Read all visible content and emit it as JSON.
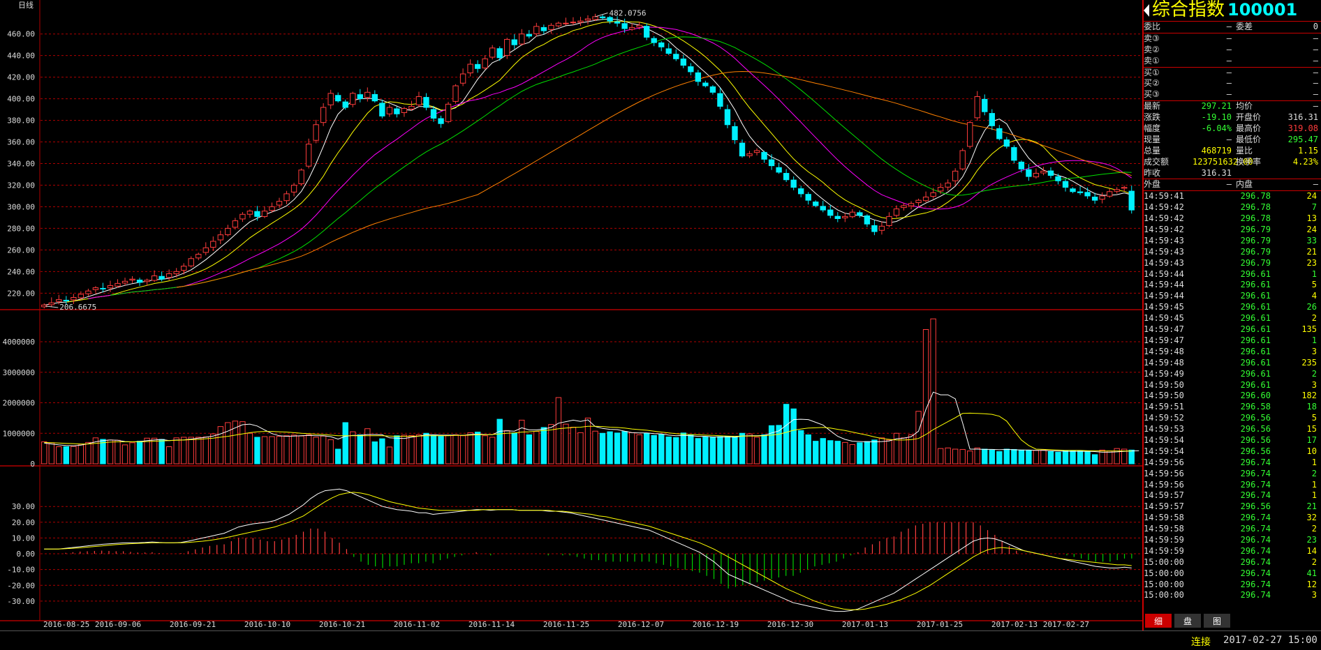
{
  "period_label": "日线",
  "colors": {
    "up": "#ff3c3c",
    "down": "#00f0ff",
    "ma5": "#ffffff",
    "ma10": "#ffff00",
    "ma20": "#ff00ff",
    "ma30": "#00e000",
    "ma60": "#ff8000",
    "grid": "#b00000",
    "dif": "#ffffff",
    "dea": "#ffff00"
  },
  "chart_data": [
    {
      "type": "candlestick",
      "ylim": [
        206,
        485
      ],
      "yticks": [
        "460.00",
        "440.00",
        "420.00",
        "400.00",
        "380.00",
        "360.00",
        "340.00",
        "320.00",
        "300.00",
        "280.00",
        "260.00",
        "240.00",
        "220.00"
      ],
      "high_label": "482.0756",
      "low_label": "206.6675",
      "x_date_labels": [
        "2016-08-25",
        "2016-09-06",
        "2016-09-21",
        "2016-10-10",
        "2016-10-21",
        "2016-11-02",
        "2016-11-14",
        "2016-11-25",
        "2016-12-07",
        "2016-12-19",
        "2016-12-30",
        "2017-01-13",
        "2017-01-25",
        "2017-02-13",
        "2017-02-27"
      ],
      "closes": [
        209,
        211,
        214,
        213,
        216,
        219,
        222,
        225,
        224,
        227,
        229,
        231,
        233,
        230,
        232,
        236,
        233,
        238,
        240,
        245,
        252,
        256,
        262,
        268,
        274,
        280,
        287,
        293,
        296,
        291,
        296,
        300,
        305,
        312,
        320,
        334,
        358,
        376,
        392,
        405,
        398,
        392,
        405,
        400,
        406,
        398,
        384,
        392,
        386,
        391,
        393,
        402,
        392,
        382,
        377,
        395,
        412,
        423,
        432,
        428,
        437,
        447,
        438,
        455,
        450,
        460,
        458,
        467,
        463,
        468,
        470,
        470,
        471,
        472,
        474,
        476,
        475,
        472,
        470,
        465,
        466,
        468,
        457,
        452,
        448,
        442,
        437,
        431,
        425,
        416,
        412,
        406,
        393,
        376,
        362,
        347,
        349,
        352,
        344,
        338,
        332,
        325,
        318,
        312,
        306,
        301,
        297,
        292,
        289,
        291,
        295,
        292,
        284,
        277,
        282,
        291,
        298,
        301,
        303,
        306,
        309,
        313,
        318,
        322,
        333,
        352,
        378,
        402,
        388,
        375,
        363,
        356,
        343,
        335,
        328,
        331,
        333,
        329,
        324,
        318,
        314,
        313,
        310,
        306,
        310,
        314,
        316,
        318,
        297
      ]
    },
    {
      "type": "bar",
      "name": "volume",
      "ylim": [
        0,
        4800000
      ],
      "yticks": [
        "4000000",
        "3000000",
        "2000000",
        "1000000",
        "0"
      ],
      "values": [
        720000,
        690000,
        560000,
        560000,
        570000,
        620000,
        700000,
        850000,
        800000,
        780000,
        770000,
        620000,
        690000,
        740000,
        840000,
        840000,
        800000,
        560000,
        850000,
        870000,
        870000,
        870000,
        880000,
        980000,
        1220000,
        1350000,
        1400000,
        1380000,
        1000000,
        870000,
        890000,
        890000,
        900000,
        920000,
        940000,
        910000,
        950000,
        870000,
        910000,
        790000,
        480000,
        1350000,
        1050000,
        950000,
        1150000,
        720000,
        820000,
        550000,
        920000,
        940000,
        930000,
        950000,
        1000000,
        930000,
        900000,
        930000,
        950000,
        920000,
        1020000,
        1040000,
        920000,
        870000,
        1460000,
        1090000,
        1010000,
        1430000,
        950000,
        1060000,
        1190000,
        1290000,
        2170000,
        1300000,
        1200000,
        1020000,
        1500000,
        1070000,
        1000000,
        1050000,
        1010000,
        1060000,
        1020000,
        950000,
        1000000,
        930000,
        960000,
        880000,
        860000,
        1010000,
        940000,
        830000,
        890000,
        870000,
        890000,
        900000,
        880000,
        1000000,
        980000,
        870000,
        950000,
        1250000,
        1260000,
        1950000,
        1800000,
        1090000,
        950000,
        740000,
        830000,
        760000,
        740000,
        700000,
        630000,
        690000,
        730000,
        780000,
        850000,
        780000,
        1000000,
        850000,
        950000,
        1720000,
        4400000,
        4750000,
        500000,
        520000,
        480000,
        470000,
        420000,
        520000,
        480000,
        450000,
        400000,
        480000,
        470000,
        450000,
        440000,
        440000,
        450000,
        400000,
        380000,
        430000,
        430000,
        420000,
        400000,
        300000,
        450000,
        420000,
        500000,
        480000,
        450000
      ],
      "ma5": [
        680000,
        650000,
        620000,
        600000,
        590000,
        610000,
        660000,
        720000,
        760000,
        780000,
        770000,
        730000,
        720000,
        730000,
        760000,
        780000,
        800000,
        760000,
        780000,
        780000,
        810000,
        840000,
        870000,
        910000,
        980000,
        1070000,
        1180000,
        1280000,
        1300000,
        1240000,
        1110000,
        990000,
        920000,
        900000,
        910000,
        920000,
        930000,
        920000,
        920000,
        890000,
        810000,
        900000,
        930000,
        930000,
        960000,
        960000,
        950000,
        850000,
        840000,
        830000,
        870000,
        910000,
        950000,
        950000,
        940000,
        940000,
        940000,
        930000,
        960000,
        970000,
        960000,
        950000,
        1070000,
        1080000,
        1070000,
        1180000,
        1110000,
        1110000,
        1140000,
        1190000,
        1330000,
        1380000,
        1430000,
        1390000,
        1440000,
        1220000,
        1160000,
        1130000,
        1120000,
        1070000,
        1020000,
        1010000,
        1010000,
        990000,
        980000,
        940000,
        920000,
        930000,
        920000,
        900000,
        900000,
        880000,
        880000,
        880000,
        870000,
        910000,
        920000,
        920000,
        930000,
        1010000,
        1080000,
        1260000,
        1450000,
        1460000,
        1450000,
        1360000,
        1270000,
        1080000,
        900000,
        800000,
        740000,
        730000,
        720000,
        720000,
        730000,
        750000,
        820000,
        840000,
        890000,
        1070000,
        1780000,
        2350000,
        2260000,
        2260000,
        2130000,
        1340000,
        480000,
        480000,
        470000,
        470000,
        460000,
        470000,
        460000,
        450000,
        450000,
        440000,
        440000,
        430000,
        420000,
        410000,
        410000,
        410000,
        410000,
        400000,
        380000,
        380000,
        390000,
        410000,
        420000,
        430000
      ],
      "ma10": [
        700000,
        690000,
        680000,
        670000,
        660000,
        650000,
        650000,
        670000,
        690000,
        710000,
        720000,
        720000,
        720000,
        720000,
        730000,
        740000,
        750000,
        760000,
        770000,
        780000,
        790000,
        800000,
        820000,
        840000,
        870000,
        900000,
        940000,
        980000,
        1020000,
        1050000,
        1060000,
        1060000,
        1050000,
        1040000,
        1020000,
        1000000,
        990000,
        970000,
        960000,
        940000,
        920000,
        920000,
        920000,
        920000,
        920000,
        920000,
        920000,
        910000,
        900000,
        900000,
        900000,
        910000,
        920000,
        920000,
        920000,
        920000,
        930000,
        930000,
        940000,
        950000,
        950000,
        960000,
        980000,
        1000000,
        1010000,
        1040000,
        1050000,
        1070000,
        1090000,
        1110000,
        1150000,
        1170000,
        1190000,
        1200000,
        1230000,
        1230000,
        1220000,
        1200000,
        1190000,
        1170000,
        1140000,
        1120000,
        1100000,
        1070000,
        1040000,
        1010000,
        990000,
        970000,
        960000,
        950000,
        940000,
        930000,
        920000,
        910000,
        900000,
        910000,
        910000,
        910000,
        920000,
        940000,
        970000,
        1030000,
        1100000,
        1140000,
        1170000,
        1180000,
        1190000,
        1170000,
        1130000,
        1090000,
        1040000,
        990000,
        940000,
        880000,
        830000,
        800000,
        780000,
        780000,
        790000,
        830000,
        960000,
        1120000,
        1250000,
        1380000,
        1510000,
        1650000,
        1660000,
        1650000,
        1640000,
        1620000,
        1560000,
        1400000,
        1080000,
        780000,
        600000,
        480000,
        470000,
        460000,
        450000,
        440000,
        440000,
        440000,
        430000,
        430000,
        420000,
        420000,
        420000,
        420000,
        420000
      ]
    },
    {
      "type": "line",
      "name": "macd",
      "ylim": [
        -38,
        46
      ],
      "yticks": [
        "30.00",
        "20.00",
        "10.00",
        "0.00",
        "-10.00",
        "-20.00",
        "-30.00"
      ],
      "dif": [
        3,
        3,
        3,
        3.5,
        4,
        4.5,
        5,
        5.5,
        6,
        6.3,
        6.6,
        6.9,
        7,
        7,
        7.2,
        7.5,
        7.2,
        7,
        7,
        7.2,
        8,
        9,
        10,
        11,
        12,
        13,
        15,
        17,
        18,
        19,
        19.5,
        20,
        21,
        23,
        25,
        28,
        31,
        35,
        38,
        40,
        40.5,
        41,
        40,
        38,
        36,
        34,
        32,
        30,
        29,
        28,
        27.5,
        27,
        26,
        26,
        25,
        25.5,
        26,
        26.5,
        27,
        27.5,
        28,
        28,
        27.5,
        28,
        28,
        28,
        27.5,
        27.5,
        27.5,
        27.5,
        27,
        27,
        26.5,
        26,
        25,
        24,
        23,
        22,
        21,
        20,
        19,
        18,
        17,
        16,
        15,
        13,
        11,
        9,
        7,
        5,
        3,
        1,
        -2,
        -5,
        -9,
        -13,
        -15,
        -17,
        -19,
        -21,
        -23,
        -25,
        -27,
        -29,
        -31,
        -32,
        -33,
        -34,
        -35,
        -36,
        -36.5,
        -36.5,
        -36,
        -35,
        -33,
        -31,
        -29,
        -27,
        -25,
        -22,
        -19,
        -16,
        -13,
        -10,
        -7,
        -4,
        -1,
        2,
        5,
        8,
        9.5,
        10,
        9.5,
        8,
        6,
        4,
        2,
        1,
        0,
        -1,
        -2,
        -3,
        -4,
        -5,
        -6,
        -7,
        -8,
        -8.5,
        -9,
        -9,
        -8.5,
        -9
      ],
      "dea": [
        3,
        3,
        3,
        3.2,
        3.5,
        3.8,
        4.2,
        4.6,
        5,
        5.4,
        5.8,
        6.1,
        6.4,
        6.6,
        6.8,
        7,
        7,
        7,
        7,
        7,
        7.2,
        7.6,
        8,
        8.5,
        9.2,
        10,
        11,
        12,
        13,
        14,
        15,
        16,
        17,
        18.5,
        20,
        22,
        24,
        27,
        30,
        33,
        35.5,
        37.5,
        38.5,
        39,
        38.5,
        37.5,
        36,
        34.5,
        33,
        32,
        31,
        30,
        29,
        28.5,
        28,
        27.5,
        27.5,
        27.5,
        27.5,
        27.5,
        27.5,
        28,
        28,
        28,
        28,
        28,
        27.5,
        27.5,
        27.5,
        27.5,
        27.5,
        27,
        27,
        26.5,
        26,
        25.5,
        25,
        24,
        23.5,
        22.5,
        21.5,
        20.5,
        19.5,
        18.5,
        17.5,
        16,
        14.5,
        13,
        11.5,
        10,
        8.5,
        7,
        5,
        3,
        0.5,
        -2,
        -4.5,
        -7,
        -9.5,
        -12,
        -14.5,
        -17,
        -19.5,
        -22,
        -24,
        -26,
        -28,
        -30,
        -31.5,
        -33,
        -34,
        -35,
        -35.5,
        -35.5,
        -35,
        -34,
        -33,
        -32,
        -30.5,
        -29,
        -27,
        -25,
        -22.5,
        -20,
        -17,
        -14,
        -11,
        -8,
        -5,
        -2,
        0.5,
        2.5,
        3.5,
        4,
        3.5,
        3,
        2,
        1,
        0,
        -1,
        -2,
        -3,
        -3.5,
        -4,
        -4.5,
        -5,
        -5.5,
        -6,
        -6.5,
        -7,
        -7,
        -7.5
      ]
    }
  ],
  "quote_panel": {
    "title": "综合指数",
    "code": "100001",
    "ratio_row": [
      "委比",
      "—",
      "委差",
      "0"
    ],
    "sell": [
      [
        "卖③",
        "—",
        "—"
      ],
      [
        "卖②",
        "—",
        "—"
      ],
      [
        "卖①",
        "—",
        "—"
      ]
    ],
    "buy": [
      [
        "买①",
        "—",
        "—"
      ],
      [
        "买②",
        "—",
        "—"
      ],
      [
        "买③",
        "—",
        "—"
      ]
    ],
    "stats": [
      [
        "最新",
        "297.21",
        "均价",
        "—"
      ],
      [
        "涨跌",
        "-19.10",
        "开盘价",
        "316.31"
      ],
      [
        "幅度",
        "-6.04%",
        "最高价",
        "319.08"
      ],
      [
        "现量",
        "—",
        "最低价",
        "295.47"
      ],
      [
        "总量",
        "468719",
        "量比",
        "1.15"
      ],
      [
        "成交额",
        "123751632.00",
        "换手率",
        "4.23%"
      ],
      [
        "昨收",
        "316.31",
        "",
        ""
      ]
    ],
    "outer_inner": [
      "外盘",
      "—",
      "内盘",
      "—"
    ],
    "ticks": [
      [
        "14:59:41",
        "296.78",
        "24"
      ],
      [
        "14:59:42",
        "296.78",
        "7"
      ],
      [
        "14:59:42",
        "296.78",
        "13"
      ],
      [
        "14:59:42",
        "296.79",
        "24"
      ],
      [
        "14:59:43",
        "296.79",
        "33"
      ],
      [
        "14:59:43",
        "296.79",
        "21"
      ],
      [
        "14:59:43",
        "296.79",
        "23"
      ],
      [
        "14:59:44",
        "296.61",
        "1"
      ],
      [
        "14:59:44",
        "296.61",
        "5"
      ],
      [
        "14:59:44",
        "296.61",
        "4"
      ],
      [
        "14:59:45",
        "296.61",
        "26"
      ],
      [
        "14:59:45",
        "296.61",
        "2"
      ],
      [
        "14:59:47",
        "296.61",
        "135"
      ],
      [
        "14:59:47",
        "296.61",
        "1"
      ],
      [
        "14:59:48",
        "296.61",
        "3"
      ],
      [
        "14:59:48",
        "296.61",
        "235"
      ],
      [
        "14:59:49",
        "296.61",
        "2"
      ],
      [
        "14:59:50",
        "296.61",
        "3"
      ],
      [
        "14:59:50",
        "296.60",
        "182"
      ],
      [
        "14:59:51",
        "296.58",
        "18"
      ],
      [
        "14:59:52",
        "296.56",
        "5"
      ],
      [
        "14:59:53",
        "296.56",
        "15"
      ],
      [
        "14:59:54",
        "296.56",
        "17"
      ],
      [
        "14:59:54",
        "296.56",
        "10"
      ],
      [
        "14:59:56",
        "296.74",
        "1"
      ],
      [
        "14:59:56",
        "296.74",
        "2"
      ],
      [
        "14:59:56",
        "296.74",
        "1"
      ],
      [
        "14:59:57",
        "296.74",
        "1"
      ],
      [
        "14:59:57",
        "296.56",
        "21"
      ],
      [
        "14:59:58",
        "296.74",
        "32"
      ],
      [
        "14:59:58",
        "296.74",
        "2"
      ],
      [
        "14:59:59",
        "296.74",
        "23"
      ],
      [
        "14:59:59",
        "296.74",
        "14"
      ],
      [
        "15:00:00",
        "296.74",
        "2"
      ],
      [
        "15:00:00",
        "296.74",
        "41"
      ],
      [
        "15:00:00",
        "296.74",
        "12"
      ],
      [
        "15:00:00",
        "296.74",
        "3"
      ]
    ],
    "tabs": [
      "细",
      "盘",
      "图"
    ]
  },
  "status": {
    "connection": "连接",
    "datetime": "2017-02-27 15:00"
  }
}
